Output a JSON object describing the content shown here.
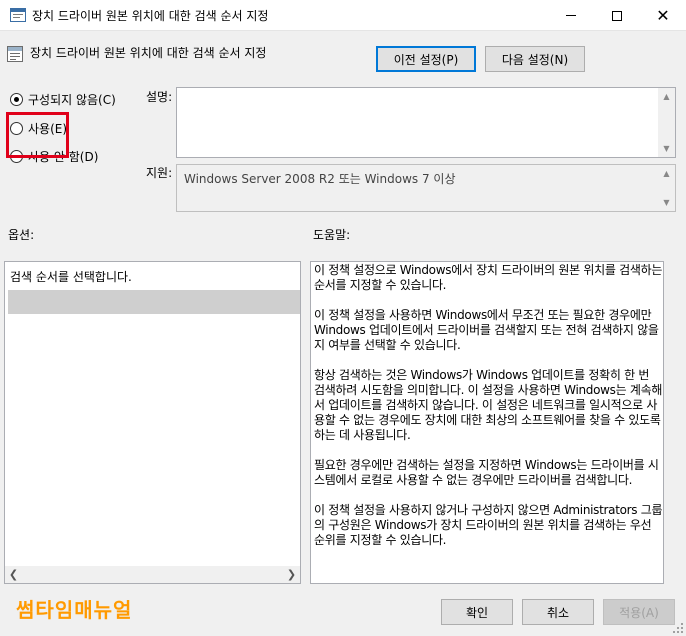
{
  "window": {
    "title": "장치 드라이버 원본 위치에 대한 검색 순서 지정",
    "minimize_glyph": "",
    "close_glyph": "✕"
  },
  "header": {
    "policy_title": "장치 드라이버 원본 위치에 대한 검색 순서 지정",
    "prev_button": "이전 설정(P)",
    "next_button": "다음 설정(N)"
  },
  "state": {
    "options": [
      {
        "label": "구성되지 않음(C)",
        "checked": true
      },
      {
        "label": "사용(E)",
        "checked": false
      },
      {
        "label": "사용 안 함(D)",
        "checked": false
      }
    ]
  },
  "labels": {
    "description": "설명:",
    "supported": "지원:",
    "options": "옵션:",
    "help": "도움말:"
  },
  "supported_on": "Windows Server 2008 R2 또는 Windows 7 이상",
  "options_pane": {
    "text": "검색 순서를 선택합니다."
  },
  "help_paragraphs": [
    "이 정책 설정으로 Windows에서 장치 드라이버의 원본 위치를 검색하는 순서를 지정할 수 있습니다.",
    "이 정책 설정을 사용하면 Windows에서 무조건 또는 필요한 경우에만 Windows 업데이트에서 드라이버를 검색할지 또는 전혀 검색하지 않을지 여부를 선택할 수 있습니다.",
    "항상 검색하는 것은 Windows가 Windows 업데이트를 정확히 한 번 검색하려 시도함을 의미합니다. 이 설정을 사용하면 Windows는 계속해서 업데이트를 검색하지 않습니다. 이 설정은 네트워크를 일시적으로 사용할 수 없는 경우에도 장치에 대한 최상의 소프트웨어를 찾을 수 있도록 하는 데 사용됩니다.",
    "필요한 경우에만 검색하는 설정을 지정하면 Windows는 드라이버를 시스템에서 로컬로 사용할 수 없는 경우에만 드라이버를 검색합니다.",
    "이 정책 설정을 사용하지 않거나 구성하지 않으면 Administrators 그룹의 구성원은 Windows가 장치 드라이버의 원본 위치를 검색하는 우선 순위를 지정할 수 있습니다."
  ],
  "footer": {
    "brand": "썸타임매뉴얼",
    "ok": "확인",
    "cancel": "취소",
    "apply": "적용(A)"
  },
  "colors": {
    "highlight": "#e0001a",
    "brand": "#ff9a00",
    "accent": "#0078d7"
  }
}
